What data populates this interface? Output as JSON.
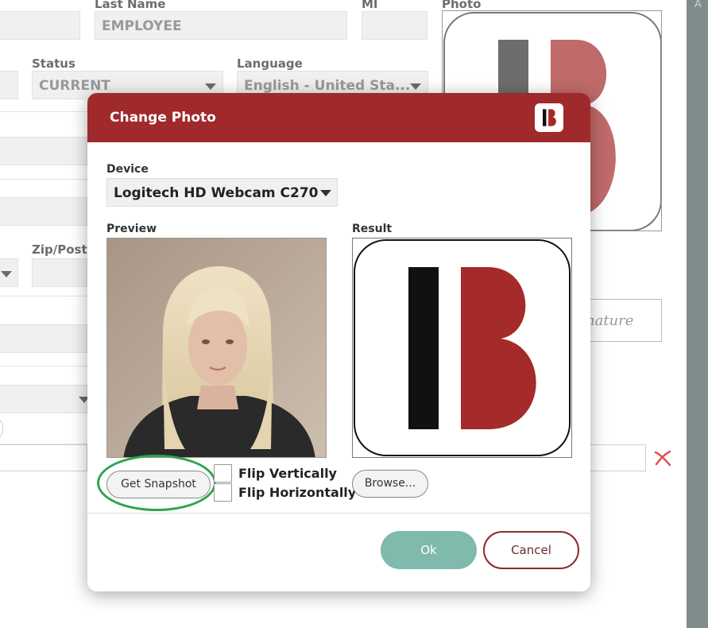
{
  "background_form": {
    "last_name_label": "Last Name",
    "last_name_value": "EMPLOYEE",
    "mi_label": "MI",
    "photo_label": "Photo",
    "status_label": "Status",
    "status_value": "CURRENT",
    "language_label": "Language",
    "language_value": "English - United Sta...",
    "zip_label": "Zip/Posta",
    "signature_placeholder": "nature",
    "right_panel_text": "A"
  },
  "modal": {
    "title": "Change Photo",
    "device_label": "Device",
    "device_value": "Logitech HD Webcam C270",
    "preview_label": "Preview",
    "result_label": "Result",
    "get_snapshot_label": "Get Snapshot",
    "flip_vertically_label": "Flip Vertically",
    "flip_horizontally_label": "Flip Horizontally",
    "browse_label": "Browse...",
    "ok_label": "Ok",
    "cancel_label": "Cancel"
  },
  "colors": {
    "header_red": "#a0292c",
    "logo_red": "#a52a2a",
    "ok_teal": "#7fbaac",
    "highlight_green": "#2ea44f"
  },
  "icons": {
    "logo": "ib-logo-icon",
    "dropdown": "chevron-down-icon",
    "clear": "clear-x-icon"
  }
}
